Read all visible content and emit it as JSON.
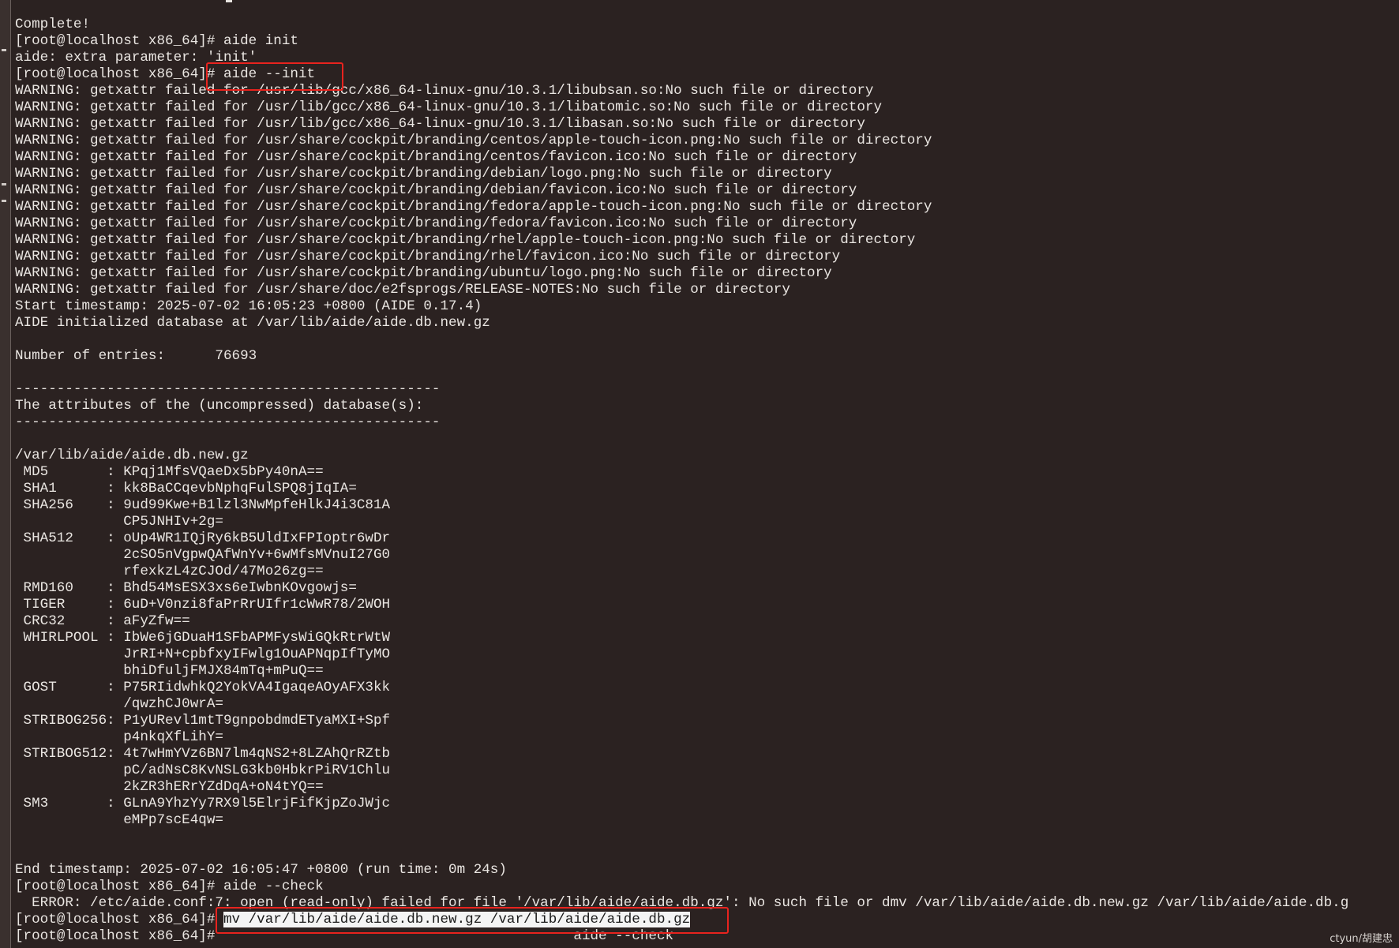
{
  "terminal": {
    "lines": [
      "Complete!",
      "[root@localhost x86_64]# aide init",
      "aide: extra parameter: 'init'",
      "[root@localhost x86_64]# aide --init",
      "WARNING: getxattr failed for /usr/lib/gcc/x86_64-linux-gnu/10.3.1/libubsan.so:No such file or directory",
      "WARNING: getxattr failed for /usr/lib/gcc/x86_64-linux-gnu/10.3.1/libatomic.so:No such file or directory",
      "WARNING: getxattr failed for /usr/lib/gcc/x86_64-linux-gnu/10.3.1/libasan.so:No such file or directory",
      "WARNING: getxattr failed for /usr/share/cockpit/branding/centos/apple-touch-icon.png:No such file or directory",
      "WARNING: getxattr failed for /usr/share/cockpit/branding/centos/favicon.ico:No such file or directory",
      "WARNING: getxattr failed for /usr/share/cockpit/branding/debian/logo.png:No such file or directory",
      "WARNING: getxattr failed for /usr/share/cockpit/branding/debian/favicon.ico:No such file or directory",
      "WARNING: getxattr failed for /usr/share/cockpit/branding/fedora/apple-touch-icon.png:No such file or directory",
      "WARNING: getxattr failed for /usr/share/cockpit/branding/fedora/favicon.ico:No such file or directory",
      "WARNING: getxattr failed for /usr/share/cockpit/branding/rhel/apple-touch-icon.png:No such file or directory",
      "WARNING: getxattr failed for /usr/share/cockpit/branding/rhel/favicon.ico:No such file or directory",
      "WARNING: getxattr failed for /usr/share/cockpit/branding/ubuntu/logo.png:No such file or directory",
      "WARNING: getxattr failed for /usr/share/doc/e2fsprogs/RELEASE-NOTES:No such file or directory",
      "Start timestamp: 2025-07-02 16:05:23 +0800 (AIDE 0.17.4)",
      "AIDE initialized database at /var/lib/aide/aide.db.new.gz",
      "",
      "Number of entries:      76693",
      "",
      "---------------------------------------------------",
      "The attributes of the (uncompressed) database(s):",
      "---------------------------------------------------",
      "",
      "/var/lib/aide/aide.db.new.gz",
      " MD5       : KPqj1MfsVQaeDx5bPy40nA==",
      " SHA1      : kk8BaCCqevbNphqFulSPQ8jIqIA=",
      " SHA256    : 9ud99Kwe+B1lzl3NwMpfeHlkJ4i3C81A",
      "             CP5JNHIv+2g=",
      " SHA512    : oUp4WR1IQjRy6kB5UldIxFPIoptr6wDr",
      "             2cSO5nVgpwQAfWnYv+6wMfsMVnuI27G0",
      "             rfexkzL4zCJOd/47Mo26zg==",
      " RMD160    : Bhd54MsESX3xs6eIwbnKOvgowjs=",
      " TIGER     : 6uD+V0nzi8faPrRrUIfr1cWwR78/2WOH",
      " CRC32     : aFyZfw==",
      " WHIRLPOOL : IbWe6jGDuaH1SFbAPMFysWiGQkRtrWtW",
      "             JrRI+N+cpbfxyIFwlg1OuAPNqpIfTyMO",
      "             bhiDfuljFMJX84mTq+mPuQ==",
      " GOST      : P75RIidwhkQ2YokVA4IgaqeAOyAFX3kk",
      "             /qwzhCJ0wrA=",
      " STRIBOG256: P1yURevl1mtT9gnpobdmdETyaMXI+Spf",
      "             p4nkqXfLihY=",
      " STRIBOG512: 4t7wHmYVz6BN7lm4qNS2+8LZAhQrRZtb",
      "             pC/adNsC8KvNSLG3kb0HbkrPiRV1Chlu",
      "             2kZR3hERrYZdDqA+oN4tYQ==",
      " SM3       : GLnA9YhzYy7RX9l5ElrjFifKjpZoJWjc",
      "             eMPp7scE4qw=",
      "",
      "",
      "End timestamp: 2025-07-02 16:05:47 +0800 (run time: 0m 24s)",
      "[root@localhost x86_64]# aide --check",
      "  ERROR: /etc/aide.conf:7: open (read-only) failed for file '/var/lib/aide/aide.db.gz': No such file or dmv /var/lib/aide/aide.db.new.gz /var/lib/aide/aide.db.g"
    ],
    "mv_prompt": "[root@localhost x86_64]# ",
    "mv_command": "mv /var/lib/aide/aide.db.new.gz /var/lib/aide/aide.db.gz",
    "last_prompt": "[root@localhost x86_64]# ",
    "last_tail": "                                          aide --check"
  },
  "watermark": "ctyun/胡建忠",
  "colors": {
    "background": "#2b2221",
    "foreground": "#eae6e2",
    "highlight_box": "#e8231e"
  }
}
